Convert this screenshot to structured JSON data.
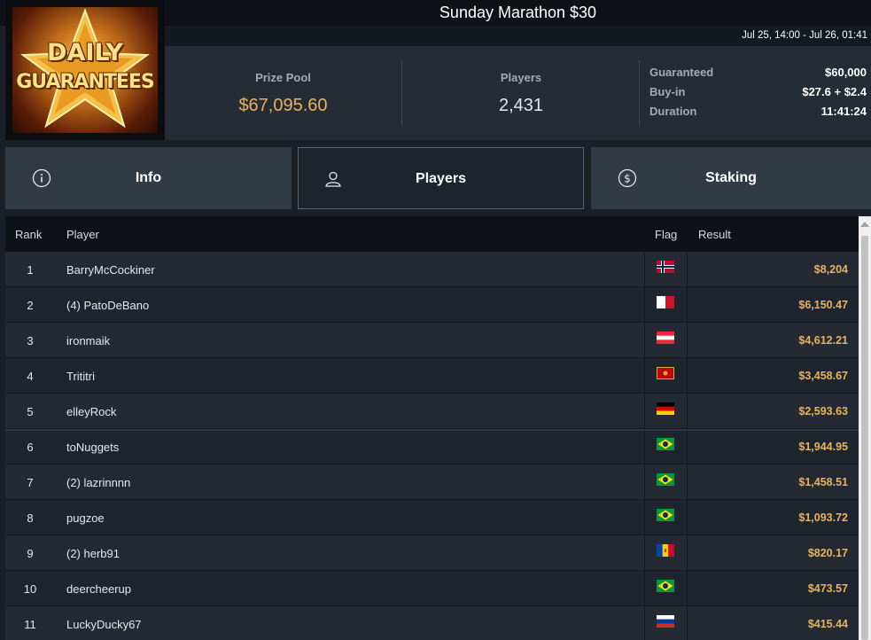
{
  "tournament": {
    "title": "Sunday Marathon $30",
    "date_range": "Jul 25, 14:00 - Jul 26, 01:41"
  },
  "logo": {
    "line1": "DAILY",
    "line2": "GUARANTEES"
  },
  "stats": {
    "prize_pool_label": "Prize Pool",
    "prize_pool_value": "$67,095.60",
    "players_label": "Players",
    "players_value": "2,431",
    "details": [
      {
        "label": "Guaranteed",
        "value": "$60,000"
      },
      {
        "label": "Buy-in",
        "value": "$27.6 + $2.4"
      },
      {
        "label": "Duration",
        "value": "11:41:24"
      }
    ]
  },
  "tabs": [
    {
      "label": "Info",
      "icon": "info-icon"
    },
    {
      "label": "Players",
      "icon": "user-icon",
      "active": true
    },
    {
      "label": "Staking",
      "icon": "dollar-coin-icon"
    }
  ],
  "table": {
    "headers": {
      "rank": "Rank",
      "player": "Player",
      "flag": "Flag",
      "result": "Result"
    },
    "rows": [
      {
        "rank": "1",
        "player": "BarryMcCockiner",
        "flag": "norway",
        "result": "$8,204"
      },
      {
        "rank": "2",
        "player": "(4) PatoDeBano",
        "flag": "malta",
        "result": "$6,150.47"
      },
      {
        "rank": "3",
        "player": "ironmaik",
        "flag": "austria",
        "result": "$4,612.21"
      },
      {
        "rank": "4",
        "player": "Trititri",
        "flag": "montenegro",
        "result": "$3,458.67"
      },
      {
        "rank": "5",
        "player": "elleyRock",
        "flag": "germany",
        "result": "$2,593.63"
      },
      {
        "rank": "6",
        "player": "toNuggets",
        "flag": "brazil",
        "result": "$1,944.95"
      },
      {
        "rank": "7",
        "player": "(2) lazrinnnn",
        "flag": "brazil",
        "result": "$1,458.51"
      },
      {
        "rank": "8",
        "player": "pugzoe",
        "flag": "brazil",
        "result": "$1,093.72"
      },
      {
        "rank": "9",
        "player": "(2) herb91",
        "flag": "moldova",
        "result": "$820.17"
      },
      {
        "rank": "10",
        "player": "deercheerup",
        "flag": "brazil",
        "result": "$473.57"
      },
      {
        "rank": "11",
        "player": "LuckyDucky67",
        "flag": "russia",
        "result": "$415.44"
      }
    ]
  },
  "colors": {
    "accent_gold": "#e8b45a",
    "background": "#1b2028",
    "header_dark": "#0e1217"
  }
}
